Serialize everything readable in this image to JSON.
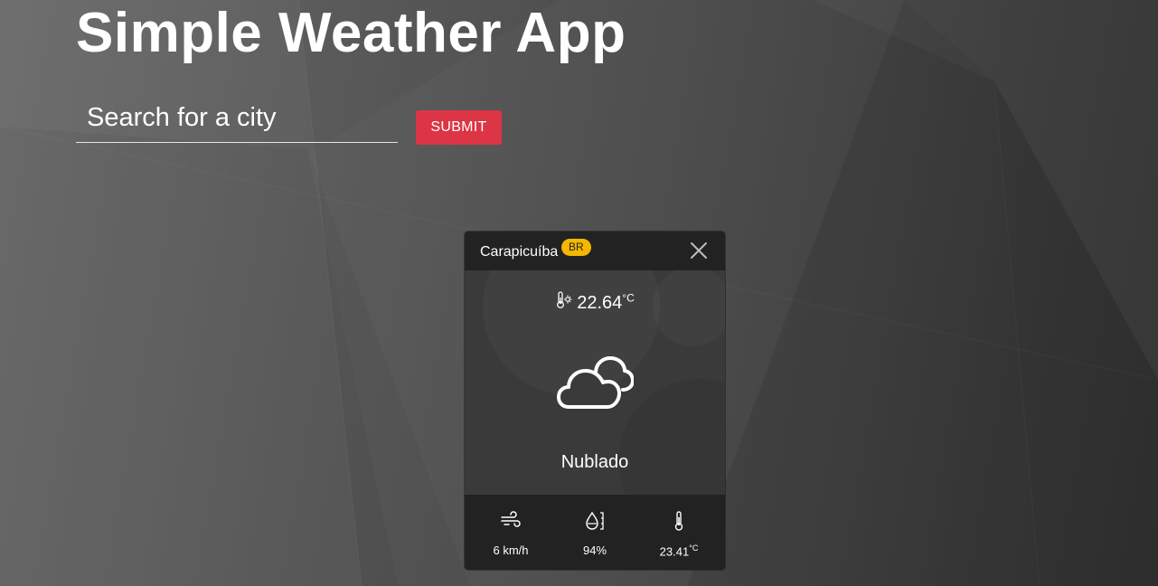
{
  "header": {
    "title": "Simple Weather App"
  },
  "search": {
    "placeholder": "Search for a city",
    "value": "",
    "submit_label": "SUBMIT"
  },
  "weather_card": {
    "city": "Carapicuíba",
    "country_code": "BR",
    "close_icon": "close-icon",
    "temperature": "22.64",
    "temperature_unit": "°C",
    "temperature_icon": "thermometer-sun-icon",
    "condition_icon": "cloud-icon",
    "condition": "Nublado",
    "stats": [
      {
        "name": "wind",
        "icon": "wind-icon",
        "value": "6 km/h",
        "unit": ""
      },
      {
        "name": "humidity",
        "icon": "humidity-icon",
        "value": "94%",
        "unit": ""
      },
      {
        "name": "feels-like",
        "icon": "thermometer-icon",
        "value": "23.41",
        "unit": "°C"
      }
    ]
  },
  "colors": {
    "submit_button": "#dc3545",
    "country_badge": "#f5b800",
    "card_header": "#222222",
    "card_body": "#3a3a3a",
    "text": "#ffffff"
  }
}
